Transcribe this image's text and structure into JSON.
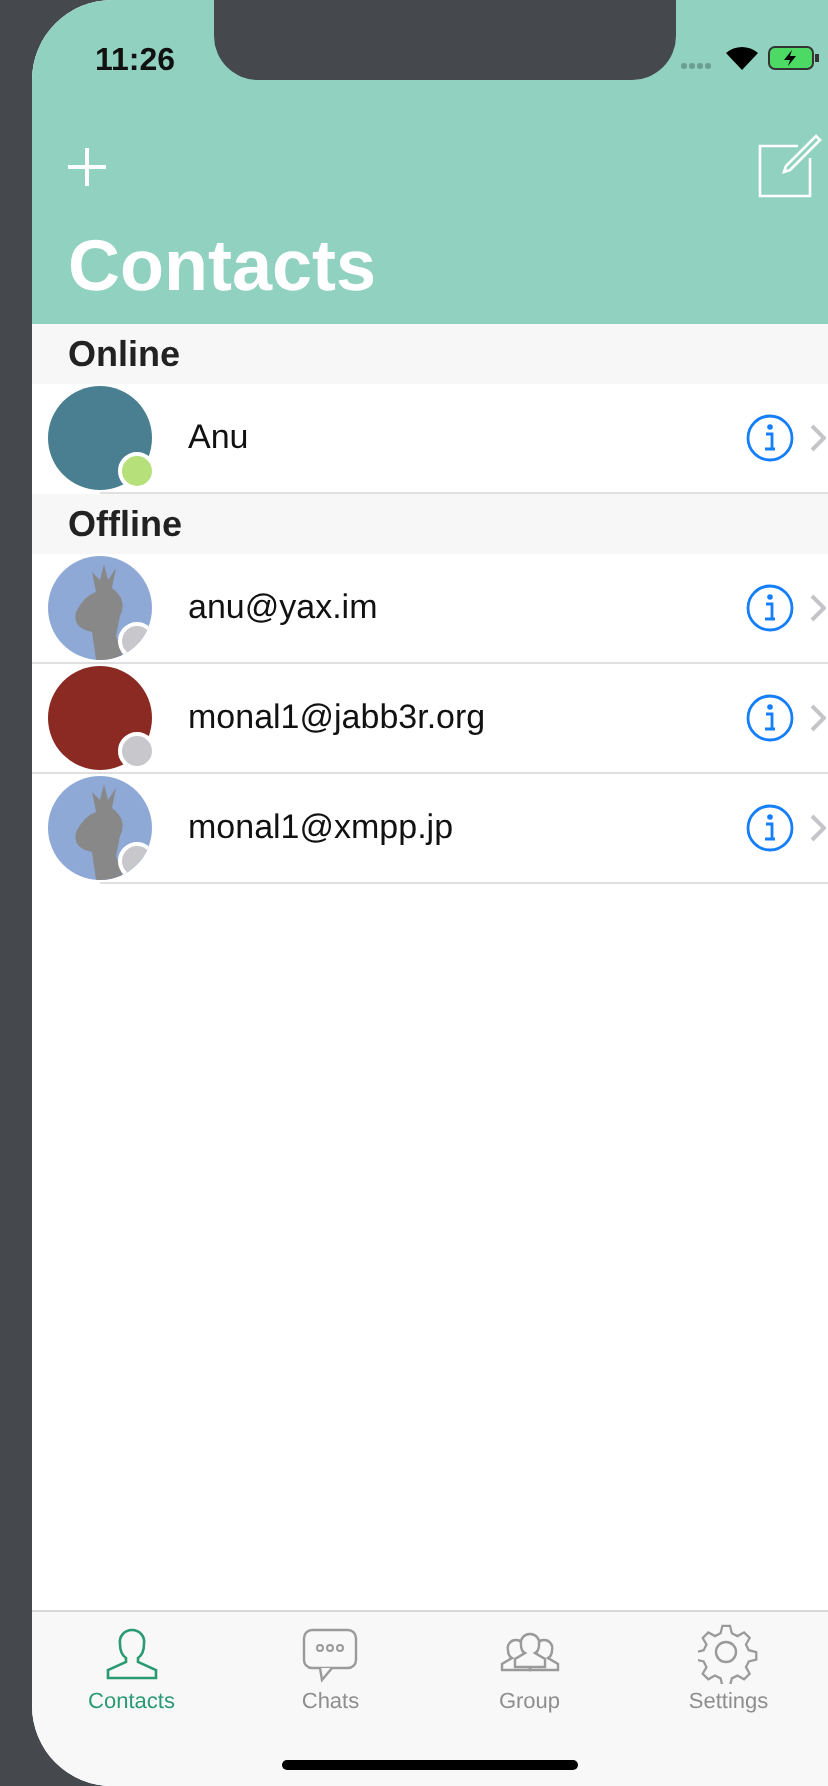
{
  "status_bar": {
    "time": "11:26"
  },
  "nav": {
    "title": "Contacts"
  },
  "sections": [
    {
      "title": "Online",
      "contacts": [
        {
          "name": "Anu",
          "kind": "photo",
          "online": true
        }
      ]
    },
    {
      "title": "Offline",
      "contacts": [
        {
          "name": "anu@yax.im",
          "kind": "default",
          "online": false
        },
        {
          "name": "monal1@jabb3r.org",
          "kind": "photo",
          "online": false
        },
        {
          "name": "monal1@xmpp.jp",
          "kind": "default",
          "online": false
        }
      ]
    }
  ],
  "tabs": [
    {
      "label": "Contacts",
      "kind": "person",
      "selected": true
    },
    {
      "label": "Chats",
      "kind": "bubble",
      "selected": false
    },
    {
      "label": "Group",
      "kind": "people",
      "selected": false
    },
    {
      "label": "Settings",
      "kind": "gear",
      "selected": false
    }
  ]
}
